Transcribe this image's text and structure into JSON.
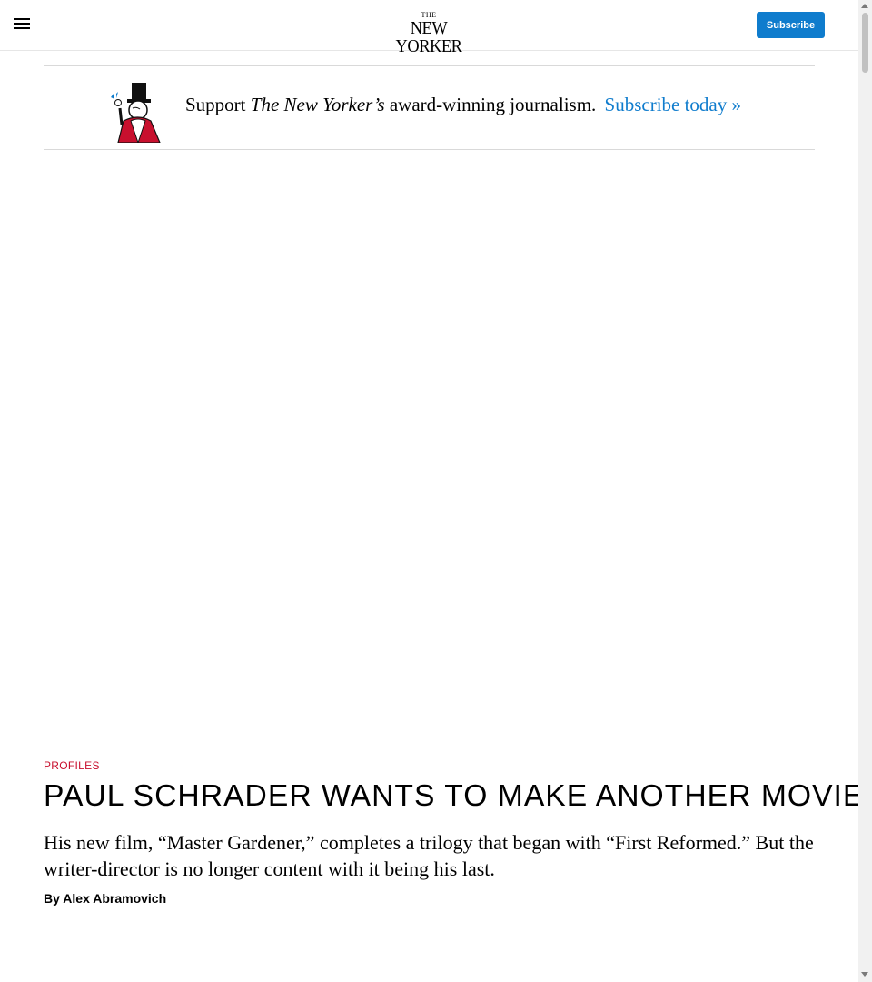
{
  "header": {
    "logo_top": "THE",
    "logo_name": "NEW YORKER",
    "subscribe_label": "Subscribe"
  },
  "promo": {
    "text_before": "Support",
    "publication": "The New Yorker’s",
    "text_after": "award-winning journalism.",
    "link_label": "Subscribe today »"
  },
  "article": {
    "rubric": "PROFILES",
    "headline": "PAUL SCHRADER WANTS TO MAKE ANOTHER MOVIE",
    "dek": "His new film, “Master Gardener,” completes a trilogy that began with “First Reformed.” But the writer-director is no longer content with it being his last.",
    "byline_prefix": "By",
    "author": "Alex Abramovich"
  },
  "colors": {
    "accent": "#0f7ccd",
    "rubric": "#c8102e"
  }
}
